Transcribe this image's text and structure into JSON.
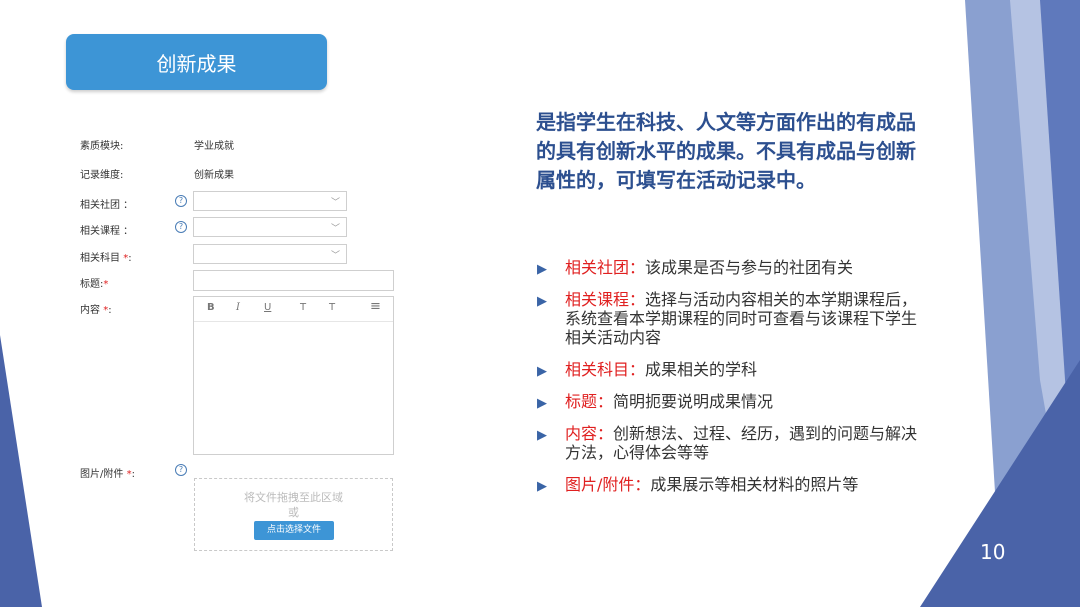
{
  "header": {
    "title": "创新成果"
  },
  "form": {
    "fields": [
      {
        "label": "素质模块:",
        "value": "学业成就"
      },
      {
        "label": "记录维度:",
        "value": "创新成果"
      }
    ],
    "club_label": "相关社团 ：",
    "course_label": "相关课程 ：",
    "subject_label": "相关科目",
    "title_label": "标题:",
    "content_label": "内容",
    "attach_label": "图片/附件",
    "required_mark": "*",
    "colon": ":",
    "help_glyph": "?",
    "toolbar": {
      "bold": "B",
      "italic": "I",
      "underline": "U",
      "superscript": "T",
      "subscript": "T",
      "align": "≡"
    },
    "upload": {
      "hint": "将文件拖拽至此区域",
      "or": "或",
      "button": "点击选择文件"
    }
  },
  "content": {
    "intro": "是指学生在科技、人文等方面作出的有成品的具有创新水平的成果。不具有成品与创新属性的，可填写在活动记录中。",
    "bullets": [
      {
        "term": "相关社团：",
        "desc": "该成果是否与参与的社团有关"
      },
      {
        "term": "相关课程：",
        "desc": "选择与活动内容相关的本学期课程后，系统查看本学期课程的同时可查看与该课程下学生相关活动内容"
      },
      {
        "term": "相关科目：",
        "desc": "成果相关的学科"
      },
      {
        "term": "标题：",
        "desc": "简明扼要说明成果情况"
      },
      {
        "term": "内容：",
        "desc": "创新想法、过程、经历，遇到的问题与解决方法，心得体会等等"
      },
      {
        "term": "图片/附件：",
        "desc": "成果展示等相关材料的照片等"
      }
    ]
  },
  "page_number": "10",
  "colors": {
    "accent": "#3d95d6",
    "intro_text": "#2c4f8f",
    "term": "#e02020",
    "deco": "#4a63a8"
  }
}
